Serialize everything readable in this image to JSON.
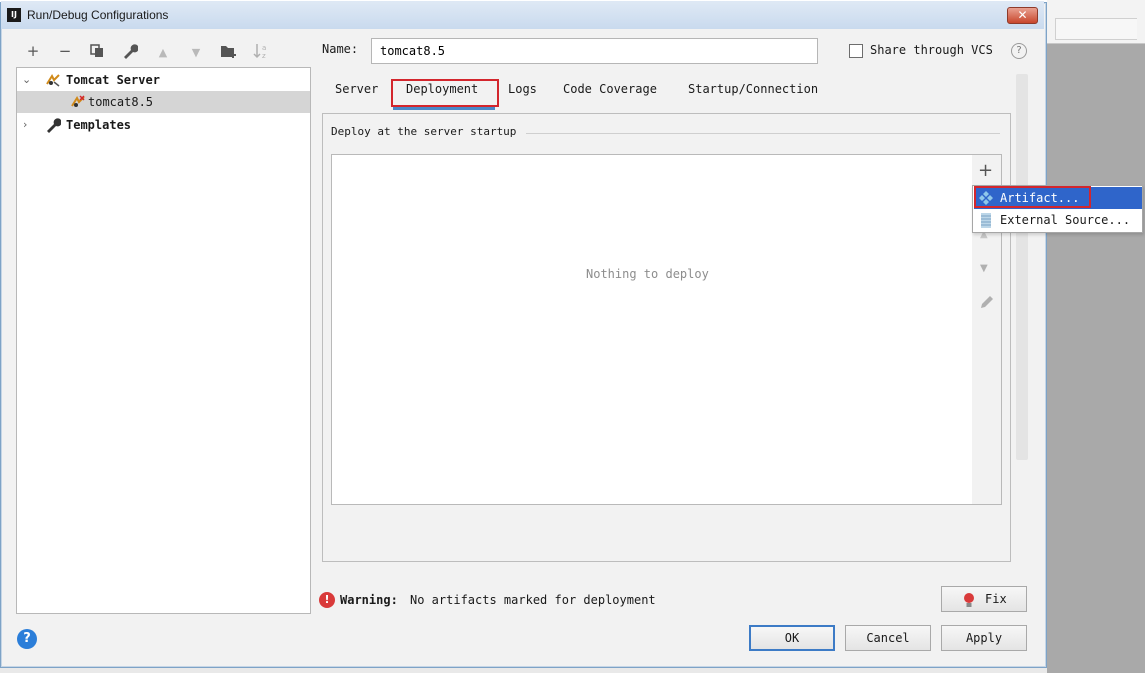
{
  "window": {
    "title": "Run/Debug Configurations",
    "app_icon_text": "IJ"
  },
  "toolbar": {
    "icons": [
      "add-icon",
      "remove-icon",
      "copy-icon",
      "wrench-icon",
      "move-up-icon",
      "move-down-icon",
      "folder-add-icon",
      "sort-icon"
    ]
  },
  "tree": {
    "items": [
      {
        "label": "Tomcat Server",
        "icon": "tomcat-icon",
        "expanded": true
      },
      {
        "label": "tomcat8.5",
        "icon": "tomcat-icon",
        "selected": true
      },
      {
        "label": "Templates",
        "icon": "wrench-icon",
        "expanded": false
      }
    ]
  },
  "config": {
    "name_label": "Name:",
    "name_value": "tomcat8.5",
    "share_label": "Share through VCS",
    "help_glyph": "?"
  },
  "tabs": [
    {
      "label": "Server"
    },
    {
      "label": "Deployment",
      "active": true
    },
    {
      "label": "Logs"
    },
    {
      "label": "Code Coverage"
    },
    {
      "label": "Startup/Connection"
    }
  ],
  "deployment": {
    "section_title": "Deploy at the server startup",
    "empty_text": "Nothing to deploy"
  },
  "popup": {
    "items": [
      {
        "label": "Artifact...",
        "icon": "artifact-icon",
        "highlighted": true
      },
      {
        "label": "External Source...",
        "icon": "external-source-icon"
      }
    ]
  },
  "warning": {
    "label": "Warning:",
    "text": "No artifacts marked for deployment",
    "fix_label": "Fix"
  },
  "buttons": {
    "ok": "OK",
    "cancel": "Cancel",
    "apply": "Apply"
  },
  "colors": {
    "accent": "#2f65ca",
    "highlight_box": "#d3262d",
    "warning": "#d93a3a",
    "help": "#2b7ed9"
  }
}
